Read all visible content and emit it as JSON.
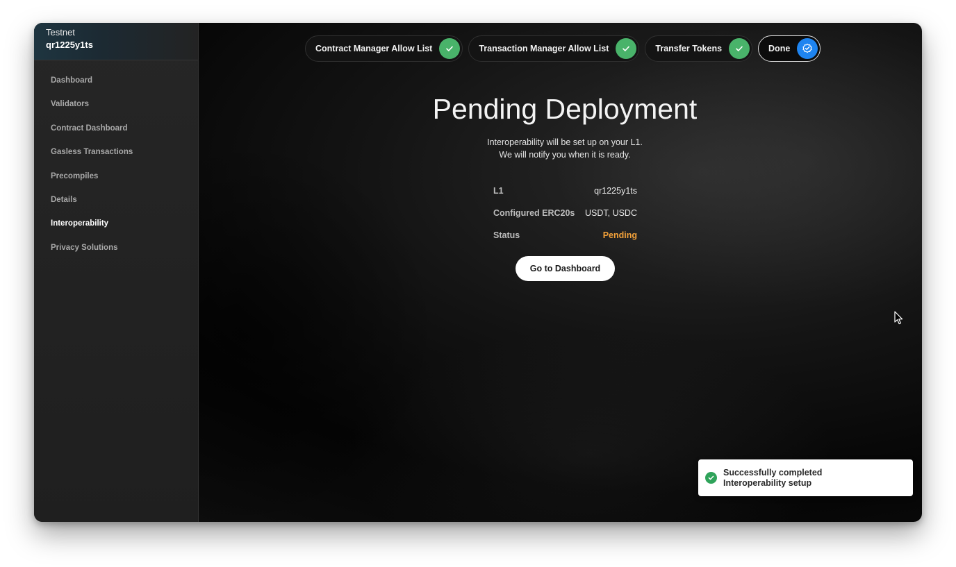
{
  "sidebar": {
    "network": "Testnet",
    "chain_id": "qr1225y1ts",
    "items": [
      {
        "label": "Dashboard"
      },
      {
        "label": "Validators"
      },
      {
        "label": "Contract Dashboard"
      },
      {
        "label": "Gasless Transactions"
      },
      {
        "label": "Precompiles"
      },
      {
        "label": "Details"
      },
      {
        "label": "Interoperability",
        "active": true
      },
      {
        "label": "Privacy Solutions"
      }
    ]
  },
  "steps": [
    {
      "label": "Contract Manager Allow List",
      "status": "complete",
      "icon": "check-icon"
    },
    {
      "label": "Transaction Manager Allow List",
      "status": "complete",
      "icon": "check-icon"
    },
    {
      "label": "Transfer Tokens",
      "status": "complete",
      "icon": "check-icon"
    },
    {
      "label": "Done",
      "status": "current",
      "icon": "badge-check-icon"
    }
  ],
  "main": {
    "title": "Pending Deployment",
    "subtitle_line1": "Interoperability will be set up on your L1.",
    "subtitle_line2": "We will notify you when it is ready.",
    "info": {
      "l1_label": "L1",
      "l1_value": "qr1225y1ts",
      "erc20_label": "Configured ERC20s",
      "erc20_value": "USDT, USDC",
      "status_label": "Status",
      "status_value": "Pending"
    },
    "go_button": "Go to Dashboard"
  },
  "toast": {
    "line1": "Successfully completed",
    "line2": "Interoperability setup"
  },
  "colors": {
    "success_green": "#49b36a",
    "current_blue": "#1e84f0",
    "pending_orange": "#f2a13a"
  }
}
